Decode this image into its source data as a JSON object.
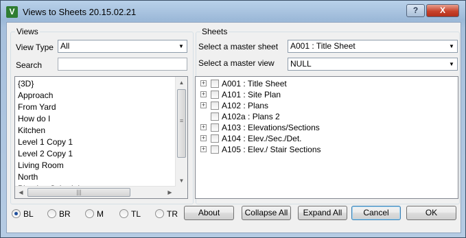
{
  "window": {
    "title": "Views to Sheets 20.15.02.21",
    "app_icon": "revit-addin-icon",
    "help_label": "?",
    "close_label": "X"
  },
  "views": {
    "group_label": "Views",
    "view_type_label": "View Type",
    "view_type_value": "All",
    "search_label": "Search",
    "search_value": "",
    "items": [
      "{3D}",
      "Approach",
      "From Yard",
      "How do I",
      "Kitchen",
      "Level 1 Copy 1",
      "Level 2 Copy 1",
      "Living Room",
      "North",
      "Planting Schedule"
    ]
  },
  "sheets": {
    "group_label": "Sheets",
    "master_sheet_label": "Select a master sheet",
    "master_sheet_value": "A001 : Title Sheet",
    "master_view_label": "Select a master view",
    "master_view_value": "NULL",
    "tree": [
      {
        "label": "A001 : Title Sheet",
        "expandable": true
      },
      {
        "label": "A101 : Site Plan",
        "expandable": true
      },
      {
        "label": "A102 : Plans",
        "expandable": true
      },
      {
        "label": "A102a : Plans 2",
        "expandable": false
      },
      {
        "label": "A103 : Elevations/Sections",
        "expandable": true
      },
      {
        "label": "A104 : Elev./Sec./Det.",
        "expandable": true
      },
      {
        "label": "A105 : Elev./ Stair Sections",
        "expandable": true
      }
    ]
  },
  "placement": {
    "selected": "BL",
    "options": [
      "BL",
      "BR",
      "M",
      "TL",
      "TR"
    ]
  },
  "buttons": {
    "about": "About",
    "collapse_all": "Collapse All",
    "expand_all": "Expand All",
    "cancel": "Cancel",
    "ok": "OK"
  }
}
